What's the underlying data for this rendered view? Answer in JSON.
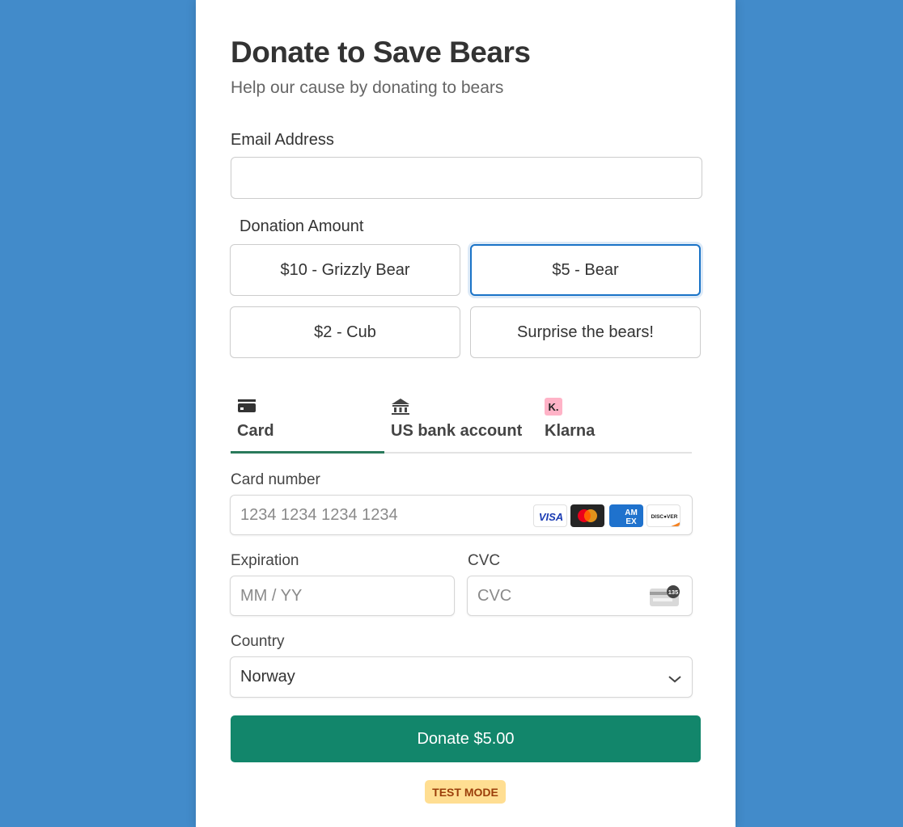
{
  "header": {
    "title": "Donate to Save Bears",
    "subtitle": "Help our cause by donating to bears"
  },
  "email": {
    "label": "Email Address",
    "value": "",
    "placeholder": ""
  },
  "donation": {
    "label": "Donation Amount",
    "options": [
      {
        "label": "$10 - Grizzly Bear",
        "selected": false
      },
      {
        "label": "$5 - Bear",
        "selected": true
      },
      {
        "label": "$2 - Cub",
        "selected": false
      },
      {
        "label": "Surprise the bears!",
        "selected": false
      }
    ]
  },
  "payment_tabs": [
    {
      "label": "Card",
      "icon": "credit-card-icon",
      "active": true
    },
    {
      "label": "US bank account",
      "icon": "bank-icon",
      "active": false
    },
    {
      "label": "Klarna",
      "icon": "klarna-icon",
      "active": false
    }
  ],
  "card": {
    "number_label": "Card number",
    "number_placeholder": "1234 1234 1234 1234",
    "brands": [
      "VISA",
      "Mastercard",
      "American Express",
      "DISCOVER"
    ],
    "expiration_label": "Expiration",
    "expiration_placeholder": "MM / YY",
    "cvc_label": "CVC",
    "cvc_placeholder": "CVC",
    "cvc_icon_text": "135"
  },
  "country": {
    "label": "Country",
    "selected": "Norway"
  },
  "submit": {
    "label": "Donate $5.00"
  },
  "badge": {
    "label": "TEST MODE"
  },
  "colors": {
    "background": "#428bca",
    "accent_green": "#12866b",
    "selected_border": "#1a73c7",
    "badge_bg": "#ffde92",
    "badge_text": "#9b3e0a",
    "klarna_pink": "#ffb3c7"
  }
}
